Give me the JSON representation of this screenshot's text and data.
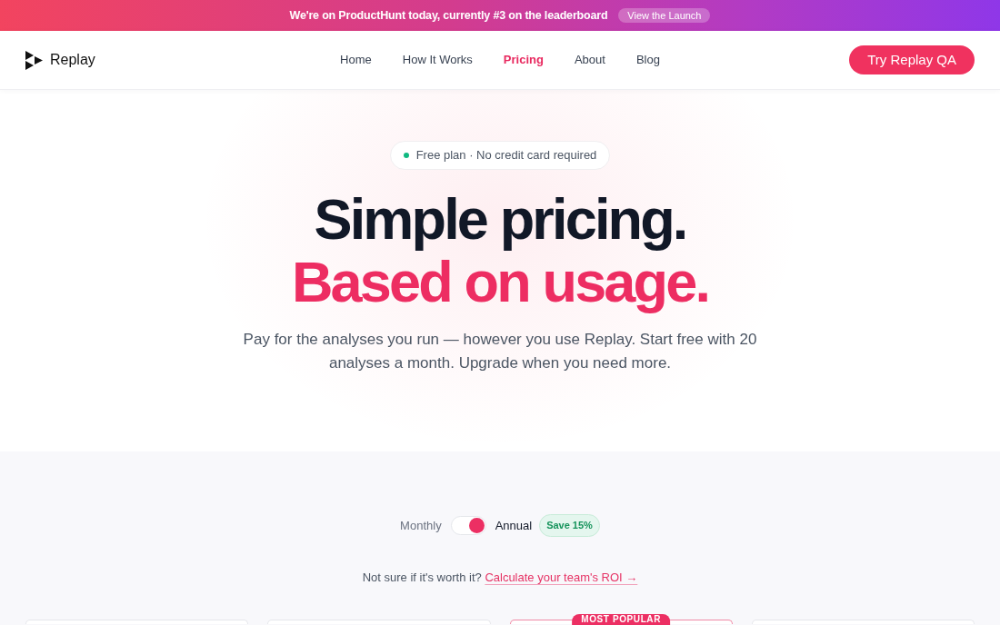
{
  "banner": {
    "text": "We're on ProductHunt today, currently #3 on the leaderboard",
    "link": "View the Launch"
  },
  "nav": {
    "brand": "Replay",
    "links": [
      {
        "label": "Home",
        "selected": false
      },
      {
        "label": "How It Works",
        "selected": false
      },
      {
        "label": "Pricing",
        "selected": true
      },
      {
        "label": "About",
        "selected": false
      },
      {
        "label": "Blog",
        "selected": false
      }
    ],
    "cta": "Try Replay QA"
  },
  "hero": {
    "pill": "Free plan · No credit card required",
    "title_line_1": "Simple pricing.",
    "title_line_2": "Based on usage.",
    "subtitle": "Pay for the analyses you run — however you use Replay. Start free with 20 analyses a month. Upgrade when you need more."
  },
  "billing": {
    "options": [
      {
        "label": "Monthly",
        "selected": false
      },
      {
        "label": "Annual",
        "selected": true
      }
    ],
    "badge": "Save 15%"
  },
  "roi": {
    "text": "Not sure if it's worth it?",
    "link": "Calculate your team's ROI →"
  },
  "plans": [
    {
      "featured": false
    },
    {
      "featured": false
    },
    {
      "featured": true,
      "badge": "MOST POPULAR"
    },
    {
      "featured": false
    }
  ]
}
